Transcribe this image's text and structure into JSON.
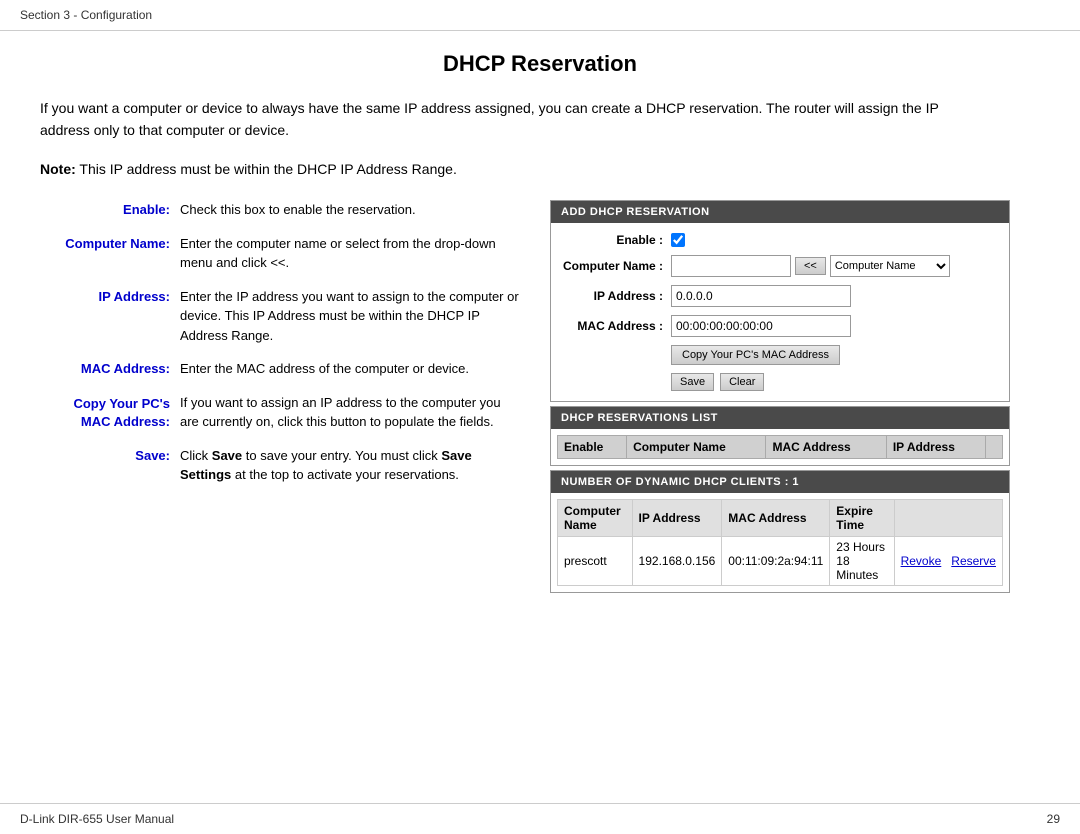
{
  "topBar": {
    "text": "Section 3 - Configuration"
  },
  "title": "DHCP Reservation",
  "intro": "If you want a computer or device to always have the same IP address assigned, you can create a DHCP reservation. The router will assign the IP address only to that computer or device.",
  "note": {
    "prefix": "Note:",
    "text": " This IP address must be within the DHCP IP Address Range."
  },
  "descriptions": [
    {
      "label": "Enable:",
      "content": "Check this box to enable the reservation."
    },
    {
      "label": "Computer Name:",
      "content": "Enter the computer name or select from the drop-down menu and click <<."
    },
    {
      "label": "IP Address:",
      "content": "Enter the IP address you want to assign to the computer or device. This IP Address must be within the DHCP IP Address Range."
    },
    {
      "label": "MAC Address:",
      "content": "Enter the MAC address of the computer or device."
    },
    {
      "label": "Copy Your PC's MAC Address:",
      "content": "If you want to assign an IP address to the computer you are currently on, click this button to populate the fields."
    },
    {
      "label": "Save:",
      "content": "Click Save to save your entry. You must click Save Settings at the top to activate your reservations.",
      "hasBoldSave": true
    }
  ],
  "addPanel": {
    "header": "ADD DHCP RESERVATION",
    "enableLabel": "Enable :",
    "computerNameLabel": "Computer Name :",
    "computerNamePlaceholder": "",
    "computerNameDropdown": "Computer Name",
    "chevron": "<<",
    "ipAddressLabel": "IP Address :",
    "ipAddressValue": "0.0.0.0",
    "macAddressLabel": "MAC Address :",
    "macAddressValue": "00:00:00:00:00:00",
    "copyMacBtn": "Copy Your PC's MAC Address",
    "saveBtn": "Save",
    "clearBtn": "Clear"
  },
  "reservationsPanel": {
    "header": "DHCP RESERVATIONS LIST",
    "columns": [
      "Enable",
      "Computer Name",
      "MAC Address",
      "IP Address"
    ],
    "rows": []
  },
  "dynamicPanel": {
    "header": "NUMBER OF DYNAMIC DHCP CLIENTS : 1",
    "columns": [
      "Computer Name",
      "IP Address",
      "MAC Address",
      "Expire Time"
    ],
    "rows": [
      {
        "computerName": "prescott",
        "ipAddress": "192.168.0.156",
        "macAddress": "00:11:09:2a:94:11",
        "expireTime": "23 Hours 18 Minutes",
        "revokeLabel": "Revoke",
        "reserveLabel": "Reserve"
      }
    ]
  },
  "bottomBar": {
    "left": "D-Link DIR-655 User Manual",
    "right": "29"
  }
}
